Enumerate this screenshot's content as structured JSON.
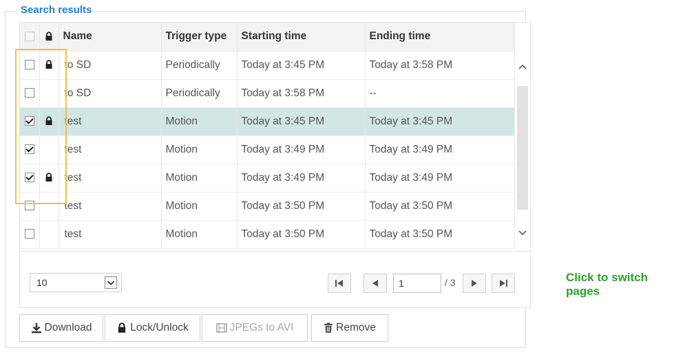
{
  "panel": {
    "legend": "Search results"
  },
  "table": {
    "columns": {
      "name": "Name",
      "trigger": "Trigger type",
      "start": "Starting time",
      "end": "Ending time"
    },
    "rows": [
      {
        "checked": false,
        "locked": true,
        "selected": false,
        "name": "to SD",
        "trigger": "Periodically",
        "start": "Today at 3:45 PM",
        "end": "Today at 3:58 PM"
      },
      {
        "checked": false,
        "locked": false,
        "selected": false,
        "name": "to SD",
        "trigger": "Periodically",
        "start": "Today at 3:58 PM",
        "end": "--"
      },
      {
        "checked": true,
        "locked": true,
        "selected": true,
        "name": "test",
        "trigger": "Motion",
        "start": "Today at 3:45 PM",
        "end": "Today at 3:45 PM"
      },
      {
        "checked": true,
        "locked": false,
        "selected": false,
        "name": "test",
        "trigger": "Motion",
        "start": "Today at 3:49 PM",
        "end": "Today at 3:49 PM"
      },
      {
        "checked": true,
        "locked": true,
        "selected": false,
        "name": "test",
        "trigger": "Motion",
        "start": "Today at 3:49 PM",
        "end": "Today at 3:49 PM"
      },
      {
        "checked": false,
        "locked": false,
        "selected": false,
        "name": "test",
        "trigger": "Motion",
        "start": "Today at 3:50 PM",
        "end": "Today at 3:50 PM"
      },
      {
        "checked": false,
        "locked": false,
        "selected": false,
        "name": "test",
        "trigger": "Motion",
        "start": "Today at 3:50 PM",
        "end": "Today at 3:50 PM"
      }
    ]
  },
  "pager": {
    "page_size": "10",
    "current_page": "1",
    "total_label": "/ 3"
  },
  "actions": {
    "download": "Download",
    "lock_unlock": "Lock/Unlock",
    "jpegs_to_avi": "JPEGs to AVI",
    "remove": "Remove"
  },
  "annotation": {
    "text": "Click to switch pages"
  },
  "colors": {
    "accent": "#2a7bd1",
    "selected_row": "#d3e6e6",
    "highlight": "#f0c040",
    "annotation": "#2fa02f"
  },
  "icons": {
    "lock": "lock-icon",
    "download": "download-icon",
    "film": "film-icon",
    "trash": "trash-icon",
    "first": "first-page-icon",
    "prev": "prev-page-icon",
    "next": "next-page-icon",
    "last": "last-page-icon"
  }
}
